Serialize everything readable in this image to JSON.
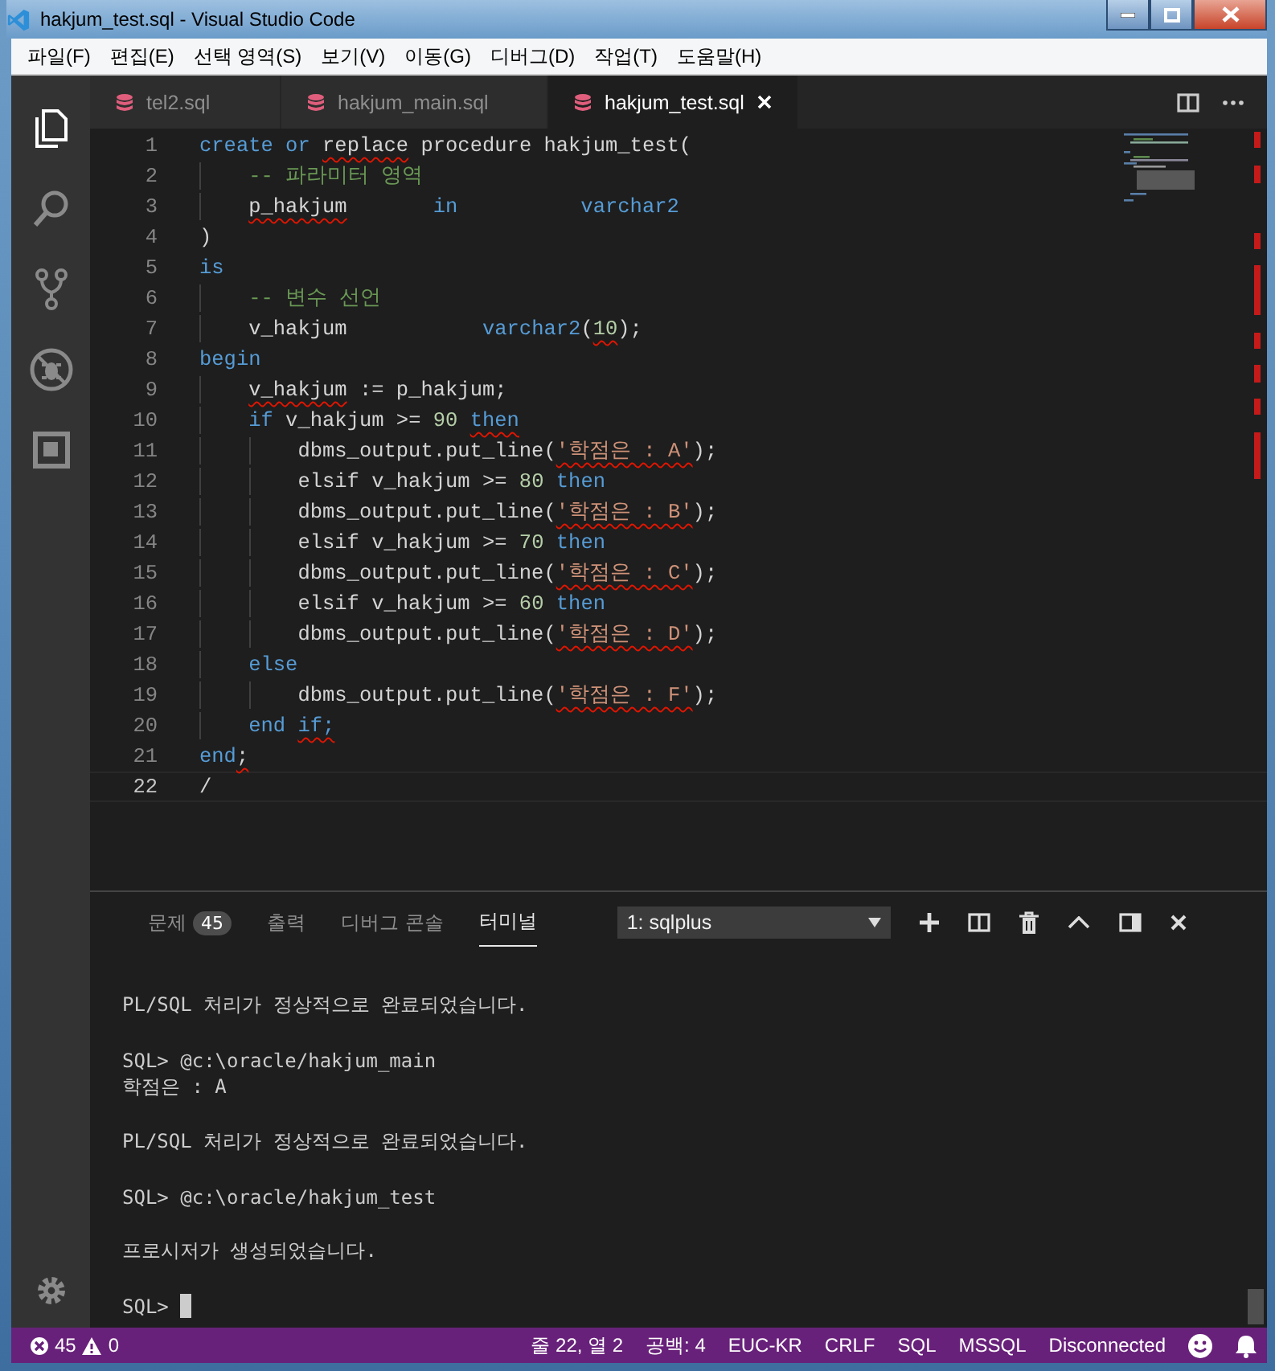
{
  "window": {
    "title": "hakjum_test.sql - Visual Studio Code"
  },
  "menu": [
    "파일(F)",
    "편집(E)",
    "선택 영역(S)",
    "보기(V)",
    "이동(G)",
    "디버그(D)",
    "작업(T)",
    "도움말(H)"
  ],
  "activity_bar": [
    {
      "kind": "files",
      "selected": true
    },
    {
      "kind": "search",
      "selected": false
    },
    {
      "kind": "git",
      "selected": false
    },
    {
      "kind": "debug",
      "selected": false
    },
    {
      "kind": "extensions",
      "selected": false
    }
  ],
  "tabs": [
    {
      "label": "tel2.sql",
      "selected": false
    },
    {
      "label": "hakjum_main.sql",
      "selected": false
    },
    {
      "label": "hakjum_test.sql",
      "selected": true
    }
  ],
  "editor": {
    "lines": [
      {
        "number": "1",
        "current": false,
        "tokens": [
          {
            "text": "create or ",
            "kind": "keyword",
            "squiggle": false
          },
          {
            "text": "replace",
            "kind": "plain",
            "squiggle": true
          },
          {
            "text": " procedure hakjum_test(",
            "kind": "plain",
            "squiggle": false
          }
        ],
        "children": [
          {
            "number": "2",
            "current": false,
            "tokens": [
              {
                "text": "-- 파라미터 영역",
                "kind": "comment",
                "squiggle": false
              }
            ]
          },
          {
            "number": "3",
            "current": false,
            "tokens": [
              {
                "text": "p_hakjum",
                "kind": "plain",
                "squiggle": true
              },
              {
                "text": "       in          varchar2",
                "kind": "keyword",
                "squiggle": false
              }
            ]
          }
        ]
      },
      {
        "number": "4",
        "current": false,
        "tokens": [
          {
            "text": ")",
            "kind": "plain",
            "squiggle": false
          }
        ]
      },
      {
        "number": "5",
        "current": false,
        "tokens": [
          {
            "text": "is",
            "kind": "keyword",
            "squiggle": false
          }
        ],
        "children": [
          {
            "number": "6",
            "current": false,
            "tokens": [
              {
                "text": "-- 변수 선언",
                "kind": "comment",
                "squiggle": false
              }
            ]
          },
          {
            "number": "7",
            "current": false,
            "tokens": [
              {
                "text": "v_hakjum           ",
                "kind": "plain",
                "squiggle": false
              },
              {
                "text": "varchar2",
                "kind": "keyword",
                "squiggle": false
              },
              {
                "text": "(",
                "kind": "plain",
                "squiggle": false
              },
              {
                "text": "10",
                "kind": "number",
                "squiggle": true
              },
              {
                "text": ");",
                "kind": "plain",
                "squiggle": false
              }
            ]
          }
        ]
      },
      {
        "number": "8",
        "current": false,
        "tokens": [
          {
            "text": "begin",
            "kind": "keyword",
            "squiggle": false
          }
        ],
        "children": [
          {
            "number": "9",
            "current": false,
            "tokens": [
              {
                "text": "v_hakjum",
                "kind": "plain",
                "squiggle": true
              },
              {
                "text": " := p_hakjum;",
                "kind": "plain",
                "squiggle": false
              }
            ]
          },
          {
            "number": "10",
            "current": false,
            "tokens": [
              {
                "text": "if",
                "kind": "keyword",
                "squiggle": false
              },
              {
                "text": " v_hakjum >= ",
                "kind": "plain",
                "squiggle": false
              },
              {
                "text": "90 ",
                "kind": "number",
                "squiggle": false
              },
              {
                "text": "then",
                "kind": "keyword",
                "squiggle": true
              }
            ],
            "children": [
              {
                "number": "11",
                "current": false,
                "tokens": [
                  {
                    "text": "dbms_output.put_line(",
                    "kind": "plain",
                    "squiggle": false
                  },
                  {
                    "text": "'학점은 : A'",
                    "kind": "string",
                    "squiggle": true
                  },
                  {
                    "text": ");",
                    "kind": "plain",
                    "squiggle": false
                  }
                ]
              },
              {
                "number": "12",
                "current": false,
                "tokens": [
                  {
                    "text": "elsif v_hakjum >= ",
                    "kind": "plain",
                    "squiggle": false
                  },
                  {
                    "text": "80",
                    "kind": "number",
                    "squiggle": false
                  },
                  {
                    "text": " then",
                    "kind": "keyword",
                    "squiggle": false
                  }
                ]
              },
              {
                "number": "13",
                "current": false,
                "tokens": [
                  {
                    "text": "dbms_output.put_line(",
                    "kind": "plain",
                    "squiggle": false
                  },
                  {
                    "text": "'학점은 : B'",
                    "kind": "string",
                    "squiggle": true
                  },
                  {
                    "text": ");",
                    "kind": "plain",
                    "squiggle": false
                  }
                ]
              },
              {
                "number": "14",
                "current": false,
                "tokens": [
                  {
                    "text": "elsif v_hakjum >= ",
                    "kind": "plain",
                    "squiggle": false
                  },
                  {
                    "text": "70",
                    "kind": "number",
                    "squiggle": false
                  },
                  {
                    "text": " then",
                    "kind": "keyword",
                    "squiggle": false
                  }
                ]
              },
              {
                "number": "15",
                "current": false,
                "tokens": [
                  {
                    "text": "dbms_output.put_line(",
                    "kind": "plain",
                    "squiggle": false
                  },
                  {
                    "text": "'학점은 : C'",
                    "kind": "string",
                    "squiggle": true
                  },
                  {
                    "text": ");",
                    "kind": "plain",
                    "squiggle": false
                  }
                ]
              },
              {
                "number": "16",
                "current": false,
                "tokens": [
                  {
                    "text": "elsif v_hakjum >= ",
                    "kind": "plain",
                    "squiggle": false
                  },
                  {
                    "text": "60",
                    "kind": "number",
                    "squiggle": false
                  },
                  {
                    "text": " then",
                    "kind": "keyword",
                    "squiggle": false
                  }
                ]
              },
              {
                "number": "17",
                "current": false,
                "tokens": [
                  {
                    "text": "dbms_output.put_line(",
                    "kind": "plain",
                    "squiggle": false
                  },
                  {
                    "text": "'학점은 : D'",
                    "kind": "string",
                    "squiggle": true
                  },
                  {
                    "text": ");",
                    "kind": "plain",
                    "squiggle": false
                  }
                ]
              }
            ]
          },
          {
            "number": "18",
            "current": false,
            "tokens": [
              {
                "text": "else",
                "kind": "keyword",
                "squiggle": false
              }
            ],
            "children": [
              {
                "number": "19",
                "current": false,
                "tokens": [
                  {
                    "text": "dbms_output.put_line(",
                    "kind": "plain",
                    "squiggle": false
                  },
                  {
                    "text": "'학점은 : F'",
                    "kind": "string",
                    "squiggle": true
                  },
                  {
                    "text": ");",
                    "kind": "plain",
                    "squiggle": false
                  }
                ]
              }
            ]
          },
          {
            "number": "20",
            "current": false,
            "tokens": [
              {
                "text": "end ",
                "kind": "keyword",
                "squiggle": false
              },
              {
                "text": "if;",
                "kind": "keyword",
                "squiggle": true
              }
            ]
          }
        ]
      },
      {
        "number": "21",
        "current": false,
        "tokens": [
          {
            "text": "end",
            "kind": "keyword",
            "squiggle": false
          },
          {
            "text": ";",
            "kind": "plain",
            "squiggle": true
          }
        ]
      },
      {
        "number": "22",
        "current": true,
        "tokens": [
          {
            "text": "/",
            "kind": "plain",
            "squiggle": false
          }
        ]
      }
    ]
  },
  "panel": {
    "tabs": [
      {
        "label": "문제",
        "badge": "45",
        "selected": false
      },
      {
        "label": "출력",
        "selected": false
      },
      {
        "label": "디버그 콘솔",
        "selected": false
      },
      {
        "label": "터미널",
        "selected": true
      }
    ],
    "terminal_select": "1: sqlplus",
    "terminal": {
      "lines": [
        {
          "text": "PL/SQL 처리가 정상적으로 완료되었습니다.",
          "blank_before": false
        },
        {
          "text": "SQL> @c:\\oracle/hakjum_main",
          "blank_before": true
        },
        {
          "text": "학점은 : A",
          "blank_before": false
        },
        {
          "text": "PL/SQL 처리가 정상적으로 완료되었습니다.",
          "blank_before": true
        },
        {
          "text": "SQL> @c:\\oracle/hakjum_test",
          "blank_before": true
        },
        {
          "text": "프로시저가 생성되었습니다.",
          "blank_before": true
        },
        {
          "text": "SQL>",
          "blank_before": true
        }
      ],
      "cursor": true
    }
  },
  "status_bar": {
    "errors": "45",
    "warnings": "0",
    "items": [
      "줄 22, 열 2",
      "공백: 4",
      "EUC-KR",
      "CRLF",
      "SQL",
      "MSSQL",
      "Disconnected"
    ]
  }
}
